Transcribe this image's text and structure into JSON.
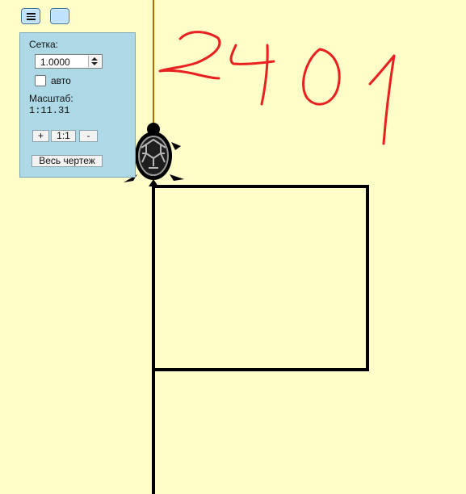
{
  "toolbar": {
    "menu_button": "hamburger-menu",
    "secondary_button": "blank"
  },
  "panel": {
    "grid_label": "Сетка:",
    "grid_value": "1.0000",
    "auto_label": "авто",
    "auto_checked": false,
    "scale_label": "Масштаб:",
    "scale_value": "1:11.31",
    "zoom_in_label": "+",
    "zoom_reset_label": "1:1",
    "zoom_out_label": "-",
    "fit_all_label": "Весь чертеж"
  },
  "canvas": {
    "handwriting": "2401",
    "colors": {
      "background": "#fffdc8",
      "panel": "#add8e6",
      "drawing": "#000000",
      "trail": "#a56f08",
      "handwriting": "#ea1d1d"
    },
    "icons": [
      "turtle-icon"
    ]
  }
}
